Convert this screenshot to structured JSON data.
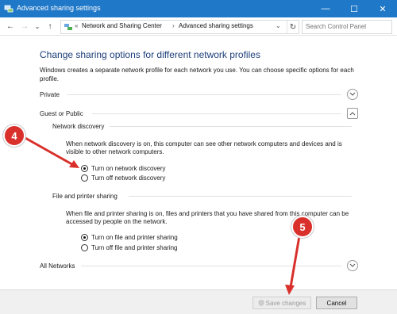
{
  "window": {
    "title": "Advanced sharing settings",
    "controls": {
      "minimize": "—",
      "maximize": "☐",
      "close": "✕"
    }
  },
  "nav": {
    "back_icon": "←",
    "forward_icon": "→",
    "recent_icon": "⌄",
    "up_icon": "↑",
    "address_sep": "«",
    "breadcrumbs": [
      "Network and Sharing Center",
      "Advanced sharing settings"
    ],
    "crumb_sep": "›",
    "dropdown_icon": "⌄",
    "refresh_icon": "↻",
    "search_placeholder": "Search Control Panel"
  },
  "main": {
    "heading": "Change sharing options for different network profiles",
    "intro": "Windows creates a separate network profile for each network you use. You can choose specific options for each profile.",
    "profiles": {
      "private": "Private",
      "guest_or_public": "Guest or Public",
      "all_networks": "All Networks"
    },
    "network_discovery": {
      "title": "Network discovery",
      "description": "When network discovery is on, this computer can see other network computers and devices and is visible to other network computers.",
      "options": [
        "Turn on network discovery",
        "Turn off network discovery"
      ],
      "selected": "Turn on network discovery"
    },
    "file_printer_sharing": {
      "title": "File and printer sharing",
      "description": "When file and printer sharing is on, files and printers that you have shared from this computer can be accessed by people on the network.",
      "options": [
        "Turn on file and printer sharing",
        "Turn off file and printer sharing"
      ],
      "selected": "Turn on file and printer sharing"
    }
  },
  "footer": {
    "save_label": "Save changes",
    "cancel_label": "Cancel"
  },
  "annotations": {
    "step_a": "4",
    "step_b": "5"
  },
  "colors": {
    "titlebar": "#1f78c8",
    "heading": "#1e3f7a",
    "badge": "#d9302b"
  }
}
